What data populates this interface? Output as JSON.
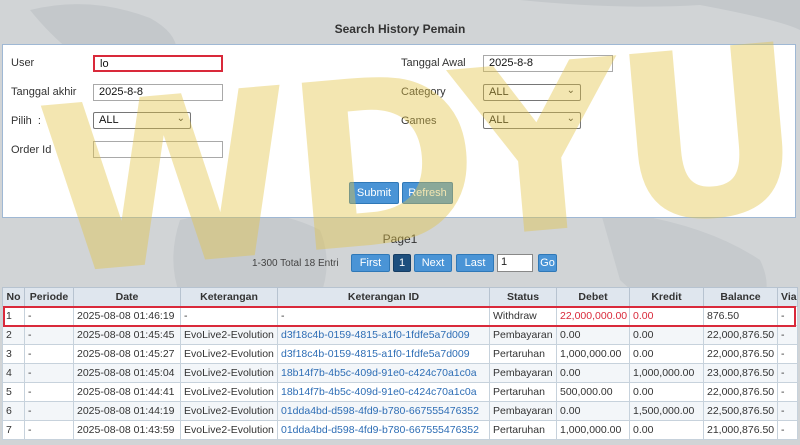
{
  "page_title": "Search History Pemain",
  "form": {
    "user_label": "User",
    "user_value": "lo",
    "tanggal_akhir_label": "Tanggal akhir",
    "tanggal_akhir_value": "2025-8-8",
    "pilih_label": "Pilih  :",
    "pilih_value": "ALL",
    "order_id_label": "Order Id",
    "order_id_value": "",
    "tanggal_awal_label": "Tanggal Awal",
    "tanggal_awal_value": "2025-8-8",
    "category_label": "Category",
    "category_value": "ALL",
    "games_label": "Games",
    "games_value": "ALL",
    "submit_label": "Submit",
    "refresh_label": "Refresh"
  },
  "pager": {
    "title": "Page1",
    "info": "1-300 Total 18 Entri",
    "first_label": "First",
    "current_page": "1",
    "next_label": "Next",
    "last_label": "Last",
    "page_input": "1",
    "go_label": "Go"
  },
  "table": {
    "headers": [
      "No",
      "Periode",
      "Date",
      "Keterangan",
      "Keterangan ID",
      "Status",
      "Debet",
      "Kredit",
      "Balance",
      "Via"
    ],
    "rows": [
      [
        "1",
        "-",
        "2025-08-08 01:46:19",
        "-",
        "-",
        "Withdraw",
        "22,000,000.00",
        "0.00",
        "876.50",
        "-"
      ],
      [
        "2",
        "-",
        "2025-08-08 01:45:45",
        "EvoLive2-Evolution",
        "d3f18c4b-0159-4815-a1f0-1fdfe5a7d009",
        "Pembayaran",
        "0.00",
        "0.00",
        "22,000,876.50",
        "-"
      ],
      [
        "3",
        "-",
        "2025-08-08 01:45:27",
        "EvoLive2-Evolution",
        "d3f18c4b-0159-4815-a1f0-1fdfe5a7d009",
        "Pertaruhan",
        "1,000,000.00",
        "0.00",
        "22,000,876.50",
        "-"
      ],
      [
        "4",
        "-",
        "2025-08-08 01:45:04",
        "EvoLive2-Evolution",
        "18b14f7b-4b5c-409d-91e0-c424c70a1c0a",
        "Pembayaran",
        "0.00",
        "1,000,000.00",
        "23,000,876.50",
        "-"
      ],
      [
        "5",
        "-",
        "2025-08-08 01:44:41",
        "EvoLive2-Evolution",
        "18b14f7b-4b5c-409d-91e0-c424c70a1c0a",
        "Pertaruhan",
        "500,000.00",
        "0.00",
        "22,000,876.50",
        "-"
      ],
      [
        "6",
        "-",
        "2025-08-08 01:44:19",
        "EvoLive2-Evolution",
        "01dda4bd-d598-4fd9-b780-667555476352",
        "Pembayaran",
        "0.00",
        "1,500,000.00",
        "22,500,876.50",
        "-"
      ],
      [
        "7",
        "-",
        "2025-08-08 01:43:59",
        "EvoLive2-Evolution",
        "01dda4bd-d598-4fd9-b780-667555476352",
        "Pertaruhan",
        "1,000,000.00",
        "0.00",
        "21,000,876.50",
        "-"
      ]
    ]
  },
  "watermark": "WDYUK",
  "colors": {
    "accent": "#4a94d6",
    "highlight": "#d9293a",
    "watermark": "#e2c446"
  }
}
